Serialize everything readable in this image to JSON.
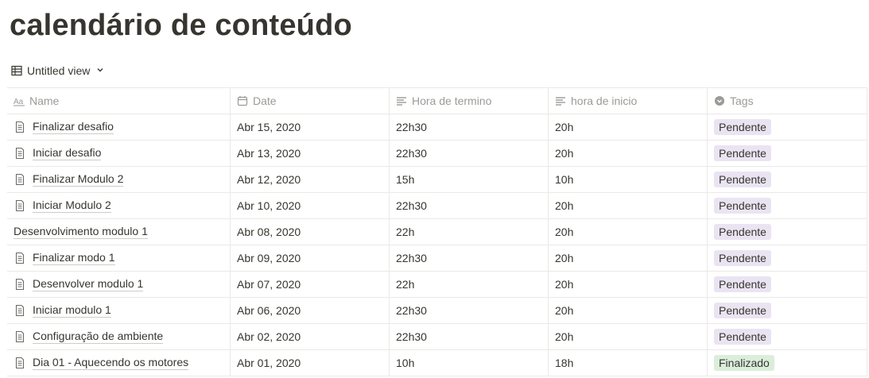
{
  "page_title": "calendário de conteúdo",
  "view": {
    "label": "Untitled view"
  },
  "columns": [
    {
      "key": "name",
      "label": "Name",
      "icon": "text-aa-icon"
    },
    {
      "key": "date",
      "label": "Date",
      "icon": "calendar-icon"
    },
    {
      "key": "end",
      "label": "Hora de termino",
      "icon": "text-lines-icon"
    },
    {
      "key": "start",
      "label": "hora de inicio",
      "icon": "text-lines-icon"
    },
    {
      "key": "tags",
      "label": "Tags",
      "icon": "tag-dropdown-icon"
    }
  ],
  "rows": [
    {
      "name": "Finalizar desafio",
      "has_icon": true,
      "date": "Abr 15, 2020",
      "end": "22h30",
      "start": "20h",
      "tag": "Pendente",
      "tag_type": "pend"
    },
    {
      "name": "Iniciar desafio",
      "has_icon": true,
      "date": "Abr 13, 2020",
      "end": "22h30",
      "start": "20h",
      "tag": "Pendente",
      "tag_type": "pend"
    },
    {
      "name": "Finalizar Modulo 2",
      "has_icon": true,
      "date": "Abr 12, 2020",
      "end": "15h",
      "start": "10h",
      "tag": "Pendente",
      "tag_type": "pend"
    },
    {
      "name": "Iniciar Modulo 2",
      "has_icon": true,
      "date": "Abr 10, 2020",
      "end": "22h30",
      "start": "20h",
      "tag": "Pendente",
      "tag_type": "pend"
    },
    {
      "name": "Desenvolvimento modulo 1",
      "has_icon": false,
      "date": "Abr 08, 2020",
      "end": "22h",
      "start": "20h",
      "tag": "Pendente",
      "tag_type": "pend"
    },
    {
      "name": "Finalizar modo 1",
      "has_icon": true,
      "date": "Abr 09, 2020",
      "end": "22h30",
      "start": "20h",
      "tag": "Pendente",
      "tag_type": "pend"
    },
    {
      "name": "Desenvolver modulo 1",
      "has_icon": true,
      "date": "Abr 07, 2020",
      "end": "22h",
      "start": "20h",
      "tag": "Pendente",
      "tag_type": "pend"
    },
    {
      "name": "Iniciar modulo 1",
      "has_icon": true,
      "date": "Abr 06, 2020",
      "end": "22h30",
      "start": "20h",
      "tag": "Pendente",
      "tag_type": "pend"
    },
    {
      "name": "Configuração de ambiente",
      "has_icon": true,
      "date": "Abr 02, 2020",
      "end": "22h30",
      "start": "20h",
      "tag": "Pendente",
      "tag_type": "pend"
    },
    {
      "name": "Dia 01 - Aquecendo os motores",
      "has_icon": true,
      "date": "Abr 01, 2020",
      "end": "10h",
      "start": "18h",
      "tag": "Finalizado",
      "tag_type": "final"
    }
  ],
  "colors": {
    "text": "#37352f",
    "muted": "#9b9a97",
    "border": "#e9e9e7",
    "tag_pending_bg": "#eae4f2",
    "tag_done_bg": "#dbeddb"
  }
}
